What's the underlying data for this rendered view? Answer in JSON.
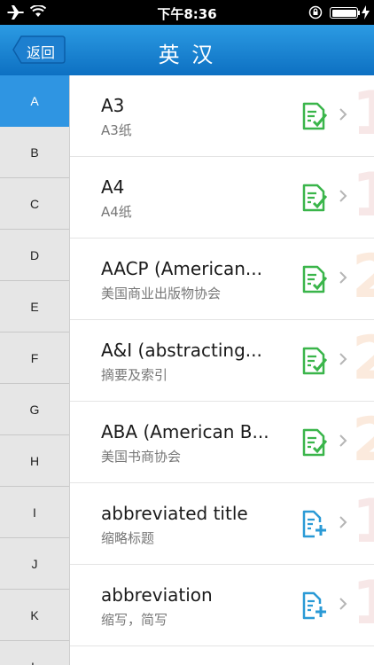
{
  "status_bar": {
    "time": "下午8:36",
    "icons": [
      "airplane-icon",
      "wifi-icon",
      "orientation-lock-icon",
      "battery-icon",
      "charging-bolt-icon"
    ]
  },
  "nav": {
    "back_label": "返回",
    "title": "英 汉"
  },
  "index": {
    "letters": [
      "A",
      "B",
      "C",
      "D",
      "E",
      "F",
      "G",
      "H",
      "I",
      "J",
      "K",
      "L"
    ],
    "selected": "A"
  },
  "colors": {
    "nav_blue": "#1a83d2",
    "green_icon": "#3ab54a",
    "blue_icon": "#2a9ad6"
  },
  "entries": [
    {
      "term": "A3",
      "meaning": "A3纸",
      "status": "reviewed",
      "icon": "doc-check-icon"
    },
    {
      "term": "A4",
      "meaning": "A4纸",
      "status": "reviewed",
      "icon": "doc-check-icon"
    },
    {
      "term": "AACP (American...",
      "meaning": "美国商业出版物协会",
      "status": "reviewed",
      "icon": "doc-check-icon"
    },
    {
      "term": "A&I (abstracting...",
      "meaning": "摘要及索引",
      "status": "reviewed",
      "icon": "doc-check-icon"
    },
    {
      "term": "ABA (American B...",
      "meaning": "美国书商协会",
      "status": "reviewed",
      "icon": "doc-check-icon"
    },
    {
      "term": "abbreviated title",
      "meaning": "缩略标题",
      "status": "new",
      "icon": "doc-add-icon"
    },
    {
      "term": "abbreviation",
      "meaning": "缩写，简写",
      "status": "new",
      "icon": "doc-add-icon"
    }
  ]
}
